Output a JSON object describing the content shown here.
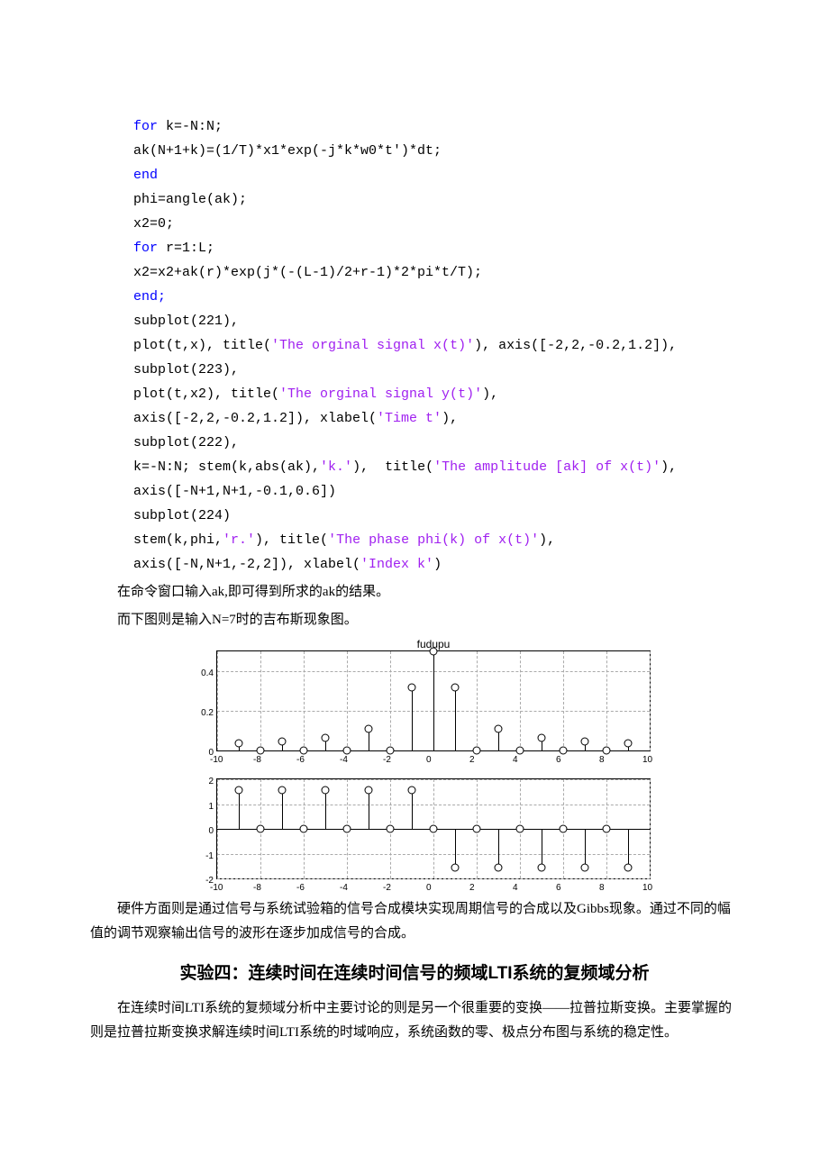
{
  "code": {
    "l1_kw": "for",
    "l1_rest": " k=-N:N;",
    "l2": "ak(N+1+k)=(1/T)*x1*exp(-j*k*w0*t')*dt;",
    "l3_kw": "end",
    "l4": "phi=angle(ak);",
    "l5": "x2=0;",
    "l6_kw": "for",
    "l6_rest": " r=1:L;",
    "l7": "x2=x2+ak(r)*exp(j*(-(L-1)/2+r-1)*2*pi*t/T);",
    "l8": "end;",
    "l9": "subplot(221),",
    "l10a": "plot(t,x), title(",
    "l10s": "'The orginal signal x(t)'",
    "l10b": "), axis([-2,2,-0.2,1.2]),",
    "l11": "subplot(223),",
    "l12a": "plot(t,x2), title(",
    "l12s": "'The orginal signal y(t)'",
    "l12b": "),",
    "l13a": "axis([-2,2,-0.2,1.2]), xlabel(",
    "l13s": "'Time t'",
    "l13b": "),",
    "l14": "subplot(222),",
    "l15a": "k=-N:N; stem(k,abs(ak),",
    "l15s1": "'k.'",
    "l15m": "),  title(",
    "l15s2": "'The amplitude [ak] of x(t)'",
    "l15b": "),",
    "l16": "axis([-N+1,N+1,-0.1,0.6])",
    "l17": "subplot(224)",
    "l18a": "stem(k,phi,",
    "l18s1": "'r.'",
    "l18m": "), title(",
    "l18s2": "'The phase phi(k) of x(t)'",
    "l18b": "),",
    "l19a": "axis([-N,N+1,-2,2]), xlabel(",
    "l19s": "'Index k'",
    "l19b": ")"
  },
  "text": {
    "p1": "在命令窗口输入ak,即可得到所求的ak的结果。",
    "p2": "而下图则是输入N=7时的吉布斯现象图。",
    "p3": "硬件方面则是通过信号与系统试验箱的信号合成模块实现周期信号的合成以及Gibbs现象。通过不同的幅值的调节观察输出信号的波形在逐步加成信号的合成。",
    "heading": "实验四：连续时间在连续时间信号的频域LTI系统的复频域分析",
    "p4": "在连续时间LTI系统的复频域分析中主要讨论的则是另一个很重要的变换——拉普拉斯变换。主要掌握的则是拉普拉斯变换求解连续时间LTI系统的时域响应，系统函数的零、极点分布图与系统的稳定性。"
  },
  "chart_data": [
    {
      "type": "stem",
      "title": "fudupu",
      "xlim": [
        -10,
        10
      ],
      "ylim": [
        0,
        0.5
      ],
      "yticks": [
        0,
        0.2,
        0.4
      ],
      "xticks": [
        -10,
        -8,
        -6,
        -4,
        -2,
        0,
        2,
        4,
        6,
        8,
        10
      ],
      "x": [
        -9,
        -8,
        -7,
        -6,
        -5,
        -4,
        -3,
        -2,
        -1,
        0,
        1,
        2,
        3,
        4,
        5,
        6,
        7,
        8,
        9
      ],
      "y": [
        0.035,
        0,
        0.045,
        0,
        0.065,
        0,
        0.11,
        0,
        0.32,
        0.5,
        0.32,
        0,
        0.11,
        0,
        0.065,
        0,
        0.045,
        0,
        0.035
      ]
    },
    {
      "type": "stem",
      "title": "",
      "xlim": [
        -10,
        10
      ],
      "ylim": [
        -2,
        2
      ],
      "yticks": [
        -2,
        -1,
        0,
        1,
        2
      ],
      "xticks": [
        -10,
        -8,
        -6,
        -4,
        -2,
        0,
        2,
        4,
        6,
        8,
        10
      ],
      "x": [
        -9,
        -8,
        -7,
        -6,
        -5,
        -4,
        -3,
        -2,
        -1,
        0,
        1,
        2,
        3,
        4,
        5,
        6,
        7,
        8,
        9
      ],
      "y": [
        1.57,
        0,
        1.57,
        0,
        1.57,
        0,
        1.57,
        0,
        1.57,
        0,
        -1.57,
        0,
        -1.57,
        0,
        -1.57,
        0,
        -1.57,
        0,
        -1.57
      ]
    }
  ]
}
